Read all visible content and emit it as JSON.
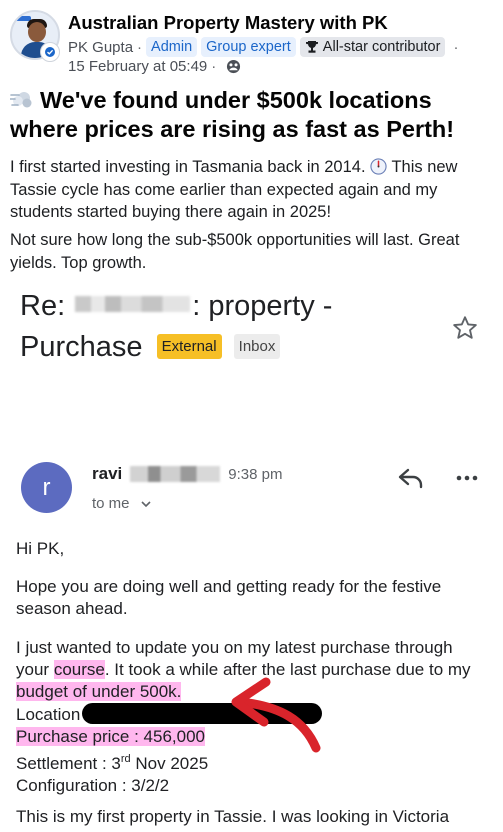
{
  "post": {
    "group_name": "Australian Property Mastery with PK",
    "author": "PK Gupta",
    "badges": {
      "admin": "Admin",
      "group_expert": "Group expert",
      "contributor": "All-star contributor"
    },
    "separator": "·",
    "date": "15 February at 05:49",
    "title": "We've found under $500k locations where prices are rising as fast as Perth!",
    "para1_a": "I first started investing in Tasmania back in 2014.",
    "para1_b": "This new Tassie cycle has come earlier than expected again and my students started buying there again in 2025!",
    "para2": "Not sure how long the sub-$500k opportunities will last. Great yields. Top growth."
  },
  "email": {
    "subject_prefix": "Re:",
    "subject_suffix": ": property - Purchase",
    "label_external": "External",
    "label_inbox": "Inbox",
    "sender_initial": "r",
    "sender_name": "ravi",
    "time": "9:38 pm",
    "to": "to me",
    "greeting": "Hi PK,",
    "line_hope": "Hope you are doing well and getting ready for the festive season ahead.",
    "line_update_a": "I just wanted to update you on my latest purchase through",
    "line_update_b_pre": "your",
    "line_update_b_course": "course",
    "line_update_b_post": ". It took a while after the last purchase due to my",
    "line_budget": "budget of under 500k.",
    "line_location": "Location",
    "line_price": "Purchase price : 456,000",
    "line_settlement_a": "Settlement : 3",
    "line_settlement_sup": "rd",
    "line_settlement_b": " Nov 2025",
    "line_config": "Configuration : 3/2/2",
    "line_first": "This is my first property in Tassie. I was looking in Victoria"
  },
  "colors": {
    "highlight": "#ffb7ee",
    "external_label": "#f6bf26",
    "sender_avatar": "#5c6bc0",
    "arrow": "#d9242b"
  }
}
